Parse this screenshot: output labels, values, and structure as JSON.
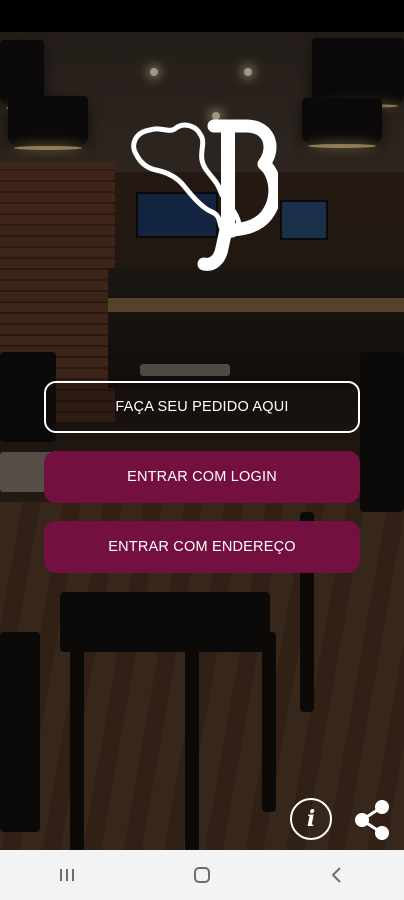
{
  "screen": {
    "background_scene": "restaurant interior",
    "accent_color": "#74103f",
    "nav_bar_color": "#f3f3f3"
  },
  "logo": {
    "letter": "B",
    "icon": "italy-map-logo"
  },
  "buttons": {
    "order_label": "FAÇA SEU PEDIDO AQUI",
    "login_label": "ENTRAR COM LOGIN",
    "address_label": "ENTRAR COM ENDEREÇO"
  },
  "actions": {
    "info_icon": "info-icon",
    "info_glyph": "i",
    "share_icon": "share-icon"
  },
  "nav": {
    "recents_icon": "recent-apps-icon",
    "home_icon": "home-icon",
    "back_icon": "back-icon"
  }
}
